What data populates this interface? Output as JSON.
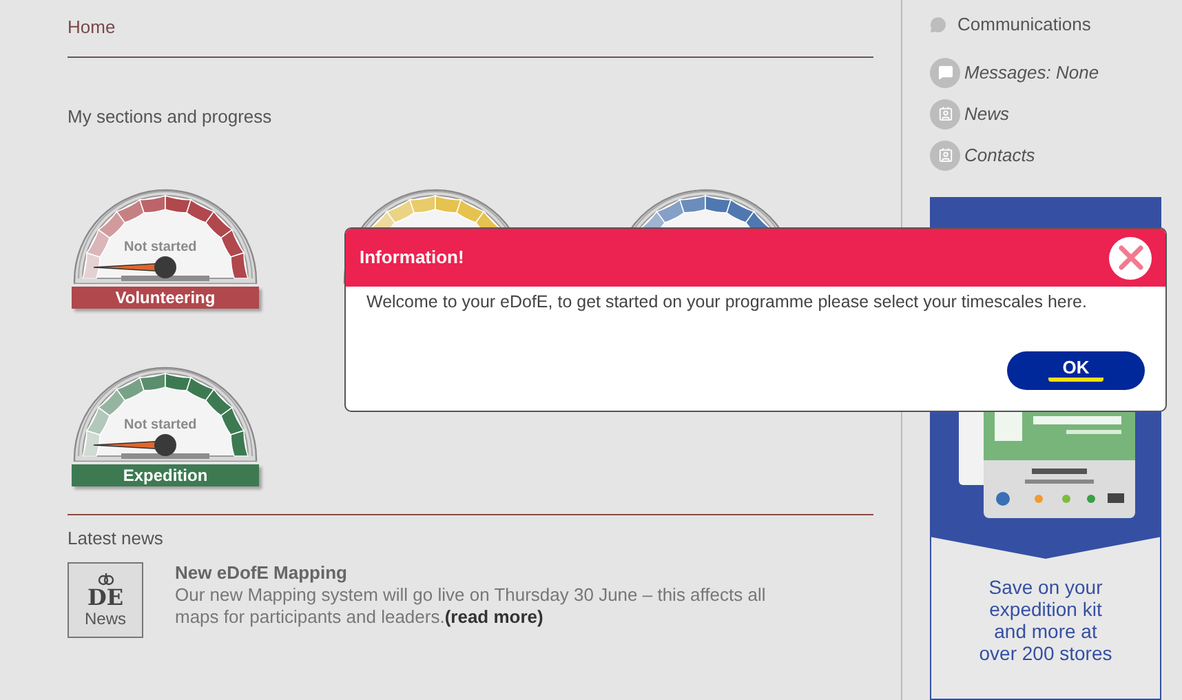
{
  "header": {
    "title": "Home"
  },
  "sections": {
    "title": "My sections and progress",
    "gauges": [
      {
        "label": "Volunteering",
        "status": "Not started",
        "color": "#b0484d"
      },
      {
        "color": "#e6c24e"
      },
      {
        "color": "#5078b0"
      },
      {
        "label": "Expedition",
        "status": "Not started",
        "color": "#3d7a52"
      }
    ]
  },
  "news": {
    "title": "Latest news",
    "items": [
      {
        "logo": "DE",
        "thumb_label": "News",
        "headline": "New eDofE Mapping",
        "body": "Our new Mapping system will go live on Thursday 30 June – this affects all maps for participants and leaders.",
        "link": "(read more)"
      }
    ]
  },
  "sidebar": {
    "title": "Communications",
    "items": [
      {
        "kind": "messages",
        "label": "Messages: None"
      },
      {
        "kind": "contact",
        "label": "News"
      },
      {
        "kind": "contact",
        "label": "Contacts"
      }
    ],
    "banner": {
      "text": "Save on your expedition kit and more at over 200 stores"
    }
  },
  "dialog": {
    "title": "Information!",
    "message": "Welcome to your eDofE, to get started on your programme please select your timescales here.",
    "button": "OK"
  }
}
